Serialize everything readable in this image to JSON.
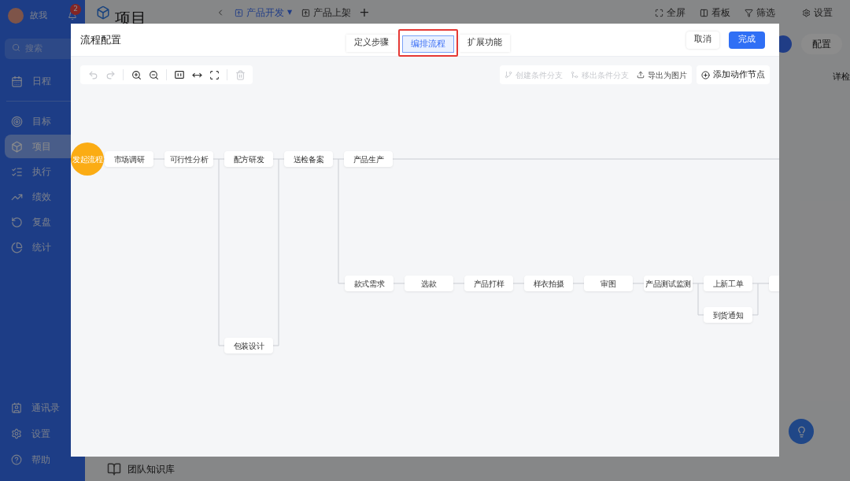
{
  "sidebar": {
    "user": {
      "name": "故我",
      "notifications": "2"
    },
    "search": {
      "placeholder": "搜索"
    },
    "top_items": [
      {
        "label": "日程",
        "selected": false
      }
    ],
    "items": [
      {
        "label": "目标",
        "selected": false
      },
      {
        "label": "项目",
        "selected": true
      },
      {
        "label": "执行",
        "selected": false
      },
      {
        "label": "绩效",
        "selected": false
      },
      {
        "label": "复盘",
        "selected": false
      },
      {
        "label": "统计",
        "selected": false
      }
    ],
    "bottom_items": [
      {
        "label": "通讯录"
      },
      {
        "label": "设置"
      },
      {
        "label": "帮助"
      }
    ]
  },
  "page": {
    "title": "项目",
    "tabs": [
      {
        "label": "产品开发",
        "selected": true,
        "caret": "▼"
      },
      {
        "label": "产品上架",
        "selected": false
      }
    ],
    "add_tab": "+",
    "actions": [
      {
        "label": "全屏"
      },
      {
        "label": "看板"
      },
      {
        "label": "筛选"
      },
      {
        "label": "设置"
      }
    ],
    "config_button": "配置",
    "column_text": "详检",
    "knowledge_base": "团队知识库"
  },
  "dialog": {
    "title": "流程配置",
    "tabs": [
      {
        "label": "定义步骤",
        "selected": false
      },
      {
        "label": "编排流程",
        "selected": true
      },
      {
        "label": "扩展功能",
        "selected": false
      }
    ],
    "cancel": "取消",
    "confirm": "完成",
    "toolbar": [
      {
        "disabled": true
      },
      {
        "disabled": true
      },
      {
        "disabled": false
      },
      {
        "disabled": false
      },
      {
        "disabled": false
      },
      {
        "disabled": false
      },
      {
        "disabled": false
      },
      {
        "disabled": true
      }
    ],
    "branch_actions": [
      {
        "label": "创建条件分支",
        "disabled": true
      },
      {
        "label": "移出条件分支",
        "disabled": true
      },
      {
        "label": "导出为图片",
        "disabled": false
      }
    ],
    "add_node": "添加动作节点",
    "flow": {
      "start": "发起流程",
      "main_row": [
        "市场调研",
        "可行性分析",
        "配方研发",
        "送检备案",
        "产品生产"
      ],
      "side_node": "包装设计",
      "second_row": [
        "款式需求",
        "选款",
        "产品打样",
        "样衣拍摄",
        "审图",
        "产品测试监测",
        "上新工单"
      ],
      "notify_node": "到货通知"
    }
  }
}
